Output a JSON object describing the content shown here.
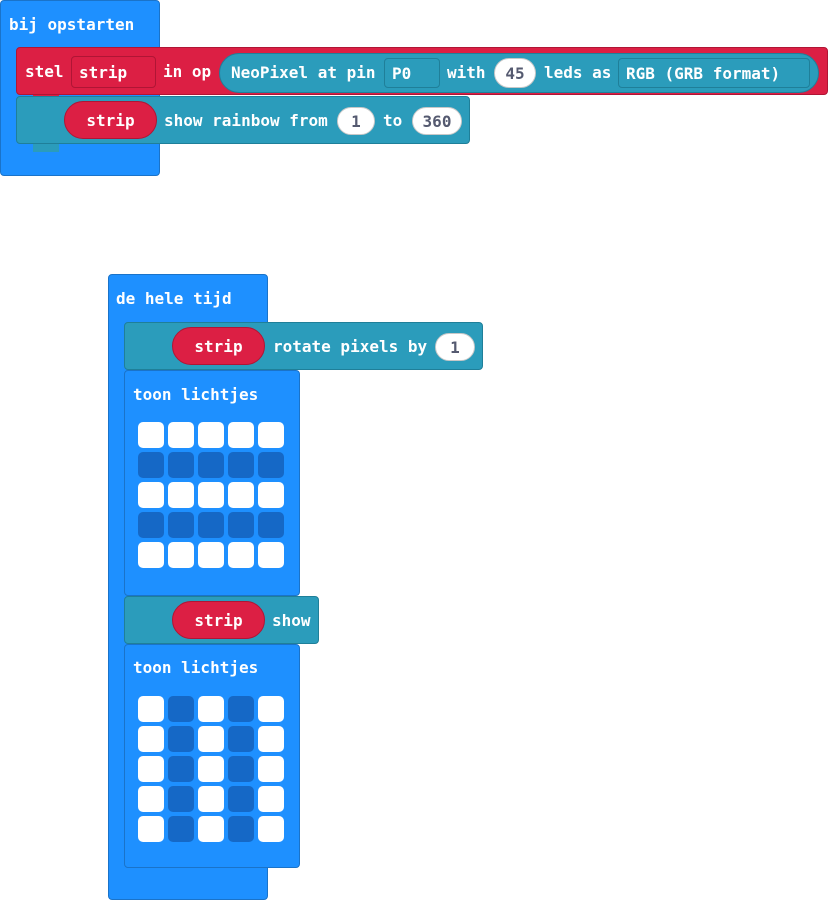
{
  "on_start": {
    "hat_label": "bij opstarten",
    "set_block": {
      "keyword": "stel",
      "variable": "strip",
      "connector": "in op",
      "neopixel": {
        "text_at_pin": "NeoPixel at pin",
        "pin": "P0",
        "text_with": "with",
        "leds": "45",
        "text_leds_as": "leds as",
        "mode": "RGB (GRB format)"
      }
    },
    "rainbow_block": {
      "variable": "strip",
      "text": "show rainbow from",
      "from": "1",
      "text_to": "to",
      "to": "360"
    }
  },
  "forever": {
    "hat_label": "de hele tijd",
    "rotate_block": {
      "variable": "strip",
      "text": "rotate pixels by",
      "amount": "1"
    },
    "show_leds_1": {
      "label": "toon lichtjes",
      "rows": [
        [
          1,
          1,
          1,
          1,
          1
        ],
        [
          0,
          0,
          0,
          0,
          0
        ],
        [
          1,
          1,
          1,
          1,
          1
        ],
        [
          0,
          0,
          0,
          0,
          0
        ],
        [
          1,
          1,
          1,
          1,
          1
        ]
      ]
    },
    "show_block": {
      "variable": "strip",
      "text": "show"
    },
    "show_leds_2": {
      "label": "toon lichtjes",
      "rows": [
        [
          1,
          0,
          1,
          0,
          1
        ],
        [
          1,
          0,
          1,
          0,
          1
        ],
        [
          1,
          0,
          1,
          0,
          1
        ],
        [
          1,
          0,
          1,
          0,
          1
        ],
        [
          1,
          0,
          1,
          0,
          1
        ]
      ]
    }
  },
  "colors": {
    "basic_blue": "#1e90ff",
    "neopixel_teal": "#2b9cbb",
    "variable_red": "#dc1f44",
    "led_on": "#ffffff",
    "led_off": "#1568c6"
  }
}
